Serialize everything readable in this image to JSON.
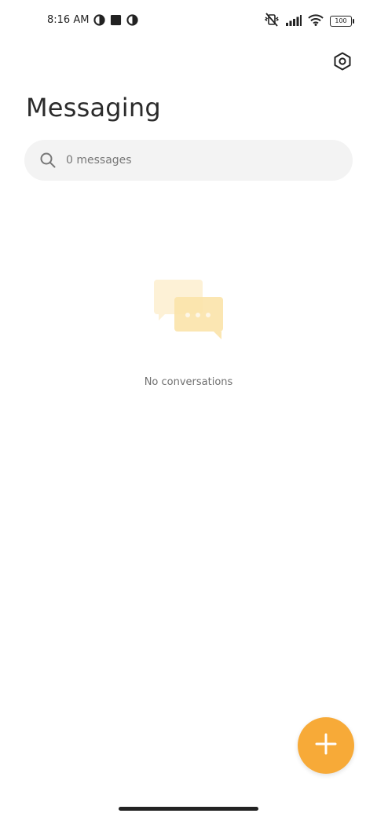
{
  "status_bar": {
    "time": "8:16 AM",
    "battery_level": "100",
    "icons": [
      "data-saver-icon",
      "app-notification-icon",
      "data-saver-icon",
      "vibrate-off-icon",
      "signal-icon",
      "wifi-icon",
      "battery-icon"
    ]
  },
  "header": {
    "title": "Messaging",
    "settings_icon": "settings-hexagon-icon"
  },
  "search": {
    "placeholder": "0 messages",
    "value": ""
  },
  "empty_state": {
    "icon": "chat-bubbles-icon",
    "text": "No conversations"
  },
  "fab": {
    "icon": "plus-icon"
  },
  "colors": {
    "accent": "#f7aa38",
    "search_bg": "#f3f3f3",
    "illustration_light": "#fdf1d6",
    "illustration_mid": "#fbe3aa"
  }
}
